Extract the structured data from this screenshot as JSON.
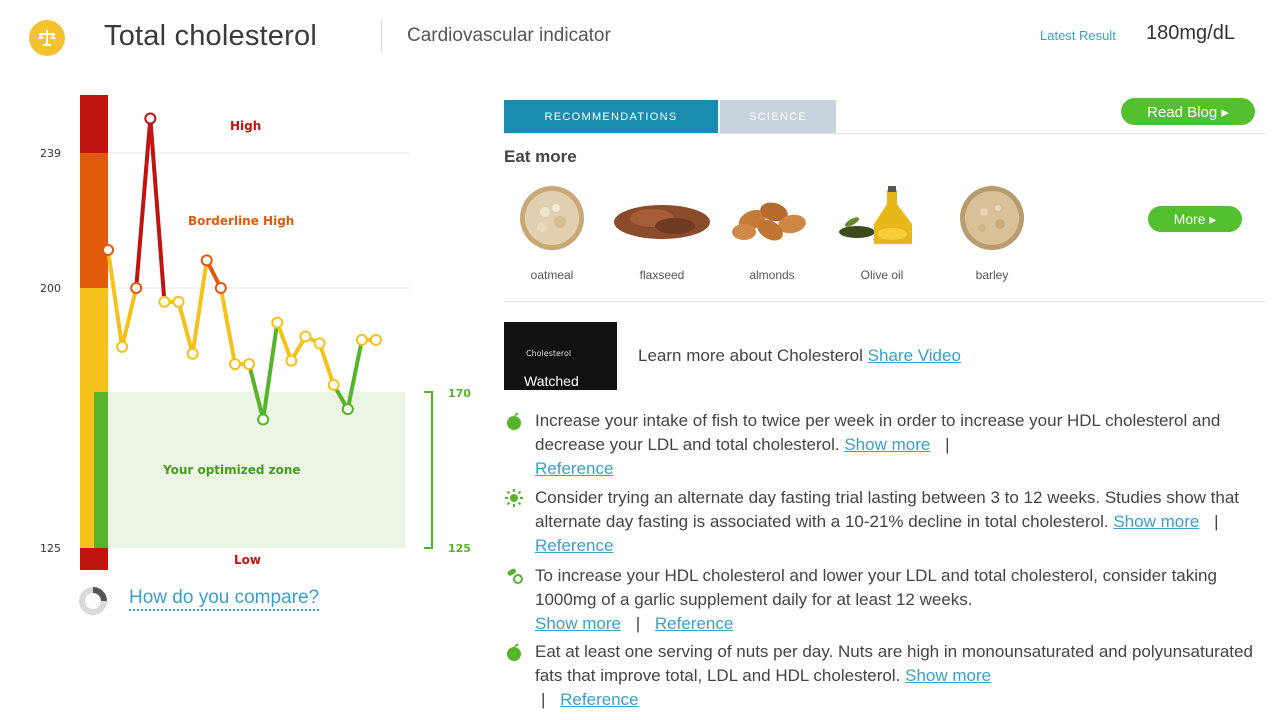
{
  "header": {
    "title": "Total cholesterol",
    "subtitle": "Cardiovascular indicator",
    "latest_label": "Latest Result",
    "latest_value": "180mg/dL",
    "logo_icon": "balance-scale-icon",
    "accent_color": "#f2c230"
  },
  "chart": {
    "zone_labels": {
      "high": "High",
      "borderline_high": "Borderline High",
      "optimized": "Your optimized zone",
      "low": "Low"
    },
    "left_ticks": [
      "239",
      "200",
      "125"
    ],
    "right_ticks": [
      "170",
      "125"
    ],
    "colors": {
      "high": "#c0140f",
      "borderline": "#e05a0c",
      "moderate": "#f4c21a",
      "optimal": "#55b52a",
      "zone_fill": "#eaf5e3"
    }
  },
  "chart_data": {
    "type": "line",
    "title": "",
    "xlabel": "",
    "ylabel": "",
    "ylim": [
      125,
      255
    ],
    "bands": [
      {
        "label": "High",
        "from": 239,
        "to": 255
      },
      {
        "label": "Borderline High",
        "from": 200,
        "to": 239
      },
      {
        "label": "Your optimized zone",
        "from": 125,
        "to": 170
      },
      {
        "label": "Low",
        "from": 118,
        "to": 125
      }
    ],
    "series": [
      {
        "values": [
          211,
          183,
          200,
          249,
          196,
          196,
          181,
          208,
          200,
          178,
          178,
          162,
          190,
          179,
          186,
          184,
          172,
          165,
          185,
          185
        ]
      }
    ]
  },
  "compare": {
    "label": "How do you compare?",
    "icon": "donut-chart-icon"
  },
  "tabs": {
    "recommendations": "RECOMMENDATIONS",
    "science": "SCIENCE"
  },
  "read_blog": "Read Blog ▸",
  "eat_more": {
    "title": "Eat more",
    "foods": [
      "oatmeal",
      "flaxseed",
      "almonds",
      "Olive oil",
      "barley"
    ],
    "more_label": "More ▸"
  },
  "video": {
    "thumb_title": "Cholesterol",
    "badge": "Watched",
    "text": "Learn more about Cholesterol",
    "link": "Share Video"
  },
  "recommendations": [
    {
      "icon": "apple-icon",
      "text": "Increase your intake of fish to twice per week in order to increase your HDL cholesterol and decrease your LDL and total cholesterol.",
      "show_more": "Show more",
      "reference": "Reference"
    },
    {
      "icon": "sun-icon",
      "text": "Consider trying an alternate day fasting trial lasting between 3 to 12 weeks. Studies show that alternate day fasting is associated with a 10-21% decline in total cholesterol.",
      "show_more": "Show more",
      "reference": "Reference"
    },
    {
      "icon": "pills-icon",
      "text": "To increase your HDL cholesterol and lower your LDL and total cholesterol, consider taking 1000mg of a garlic supplement daily for at least 12 weeks.",
      "show_more": "Show more",
      "reference": "Reference"
    },
    {
      "icon": "apple-icon",
      "text": "Eat at least one serving of nuts per day. Nuts are high in monounsaturated and polyunsaturated fats that improve total, LDL and HDL cholesterol.",
      "show_more": "Show more",
      "reference": "Reference"
    }
  ],
  "separator": "|"
}
